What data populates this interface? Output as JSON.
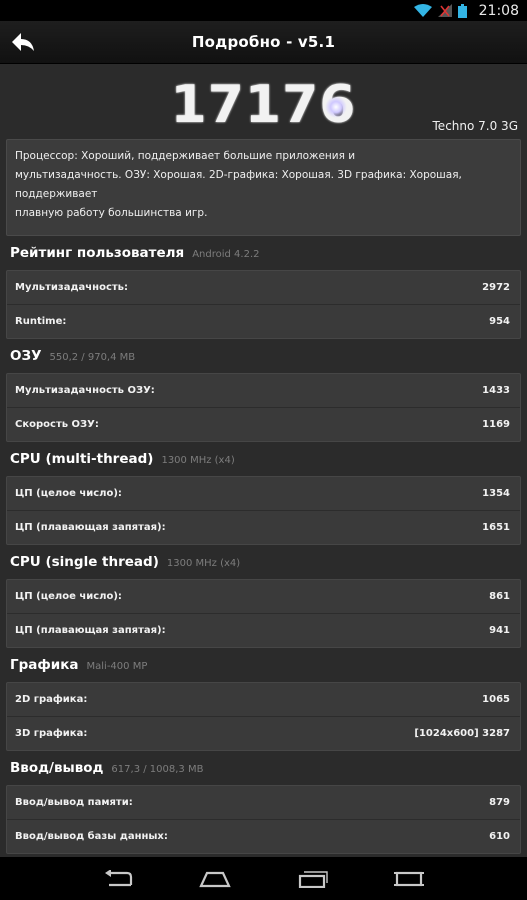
{
  "status": {
    "time": "21:08",
    "icons": [
      "wifi-icon",
      "signal-off-icon",
      "battery-icon"
    ]
  },
  "app": {
    "title": "Подробно - v5.1"
  },
  "score": {
    "value": "17176",
    "device": "Techno 7.0 3G"
  },
  "summary": {
    "line1": "Процессор: Хороший, поддерживает большие приложения и",
    "line2": "мультизадачность. ОЗУ: Хорошая. 2D-графика: Хорошая. 3D графика: Хорошая, поддерживает",
    "line3": "плавную работу большинства игр."
  },
  "sections": [
    {
      "name": "Рейтинг пользователя",
      "sub": "Android 4.2.2",
      "rows": [
        {
          "label": "Мультизадачность:",
          "value": "2972"
        },
        {
          "label": "Runtime:",
          "value": "954"
        }
      ]
    },
    {
      "name": "ОЗУ",
      "sub": "550,2 / 970,4 MB",
      "rows": [
        {
          "label": "Мультизадачность ОЗУ:",
          "value": "1433"
        },
        {
          "label": "Скорость ОЗУ:",
          "value": "1169"
        }
      ]
    },
    {
      "name": "CPU (multi-thread)",
      "sub": "1300 MHz (x4)",
      "rows": [
        {
          "label": "ЦП (целое число):",
          "value": "1354"
        },
        {
          "label": "ЦП (плавающая запятая):",
          "value": "1651"
        }
      ]
    },
    {
      "name": "CPU (single thread)",
      "sub": "1300 MHz (x4)",
      "rows": [
        {
          "label": "ЦП (целое число):",
          "value": "861"
        },
        {
          "label": "ЦП (плавающая запятая):",
          "value": "941"
        }
      ]
    },
    {
      "name": "Графика",
      "sub": "Mali-400 MP",
      "rows": [
        {
          "label": "2D графика:",
          "value": "1065"
        },
        {
          "label": "3D графика:",
          "value": "[1024x600] 3287"
        }
      ]
    },
    {
      "name": "Ввод/вывод",
      "sub": "617,3 / 1008,3 MB",
      "rows": [
        {
          "label": "Ввод/вывод памяти:",
          "value": "879"
        },
        {
          "label": "Ввод/вывод базы данных:",
          "value": "610"
        }
      ]
    }
  ],
  "nav": [
    "back-nav-icon",
    "home-icon",
    "recent-apps-icon",
    "screenshot-icon"
  ]
}
